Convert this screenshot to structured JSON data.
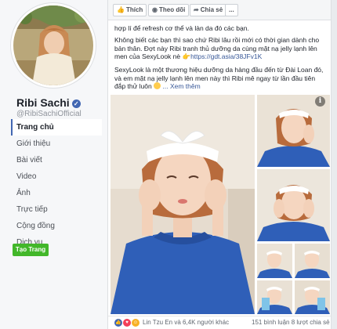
{
  "sidebar": {
    "page_name": "Ribi Sachi",
    "handle": "@RibiSachiOfficial",
    "nav": [
      "Trang chủ",
      "Giới thiệu",
      "Bài viết",
      "Video",
      "Ảnh",
      "Trực tiếp",
      "Cộng đồng",
      "Dịch vụ"
    ],
    "active_index": 0,
    "create_button": "Tạo Trang"
  },
  "post": {
    "actions": {
      "like": "Thích",
      "follow": "Theo dõi",
      "share": "Chia sẻ",
      "more": "..."
    },
    "line_top": "hợp lí để refresh cơ thể và làn da đó các bạn.",
    "para1": "Không biết các bạn thì sao chứ Ribi lâu rồi mới có thời gian dành cho bản thân. Đợt này Ribi tranh thủ dưỡng da cùng mặt nạ jelly lạnh lên men của SexyLook nè",
    "para1_link": "https://gdt.asia/38JFv1K",
    "para2": "SexyLook là một thương hiệu dưỡng da hàng đầu đến từ Đài Loan đó, và em mặt nạ jelly lạnh lên men này thì Ribi mê ngay từ lần đầu tiên đắp thử luôn",
    "see_more": "... Xem thêm",
    "reactions": {
      "names": "Lin Tzu En và 6,4K người khác",
      "stats": "151 bình luận  8 lượt chia sẻ"
    }
  },
  "colors": {
    "brand": "#4267b2",
    "link": "#385898",
    "green": "#42b72a",
    "shirt": "#2f5fb8"
  }
}
